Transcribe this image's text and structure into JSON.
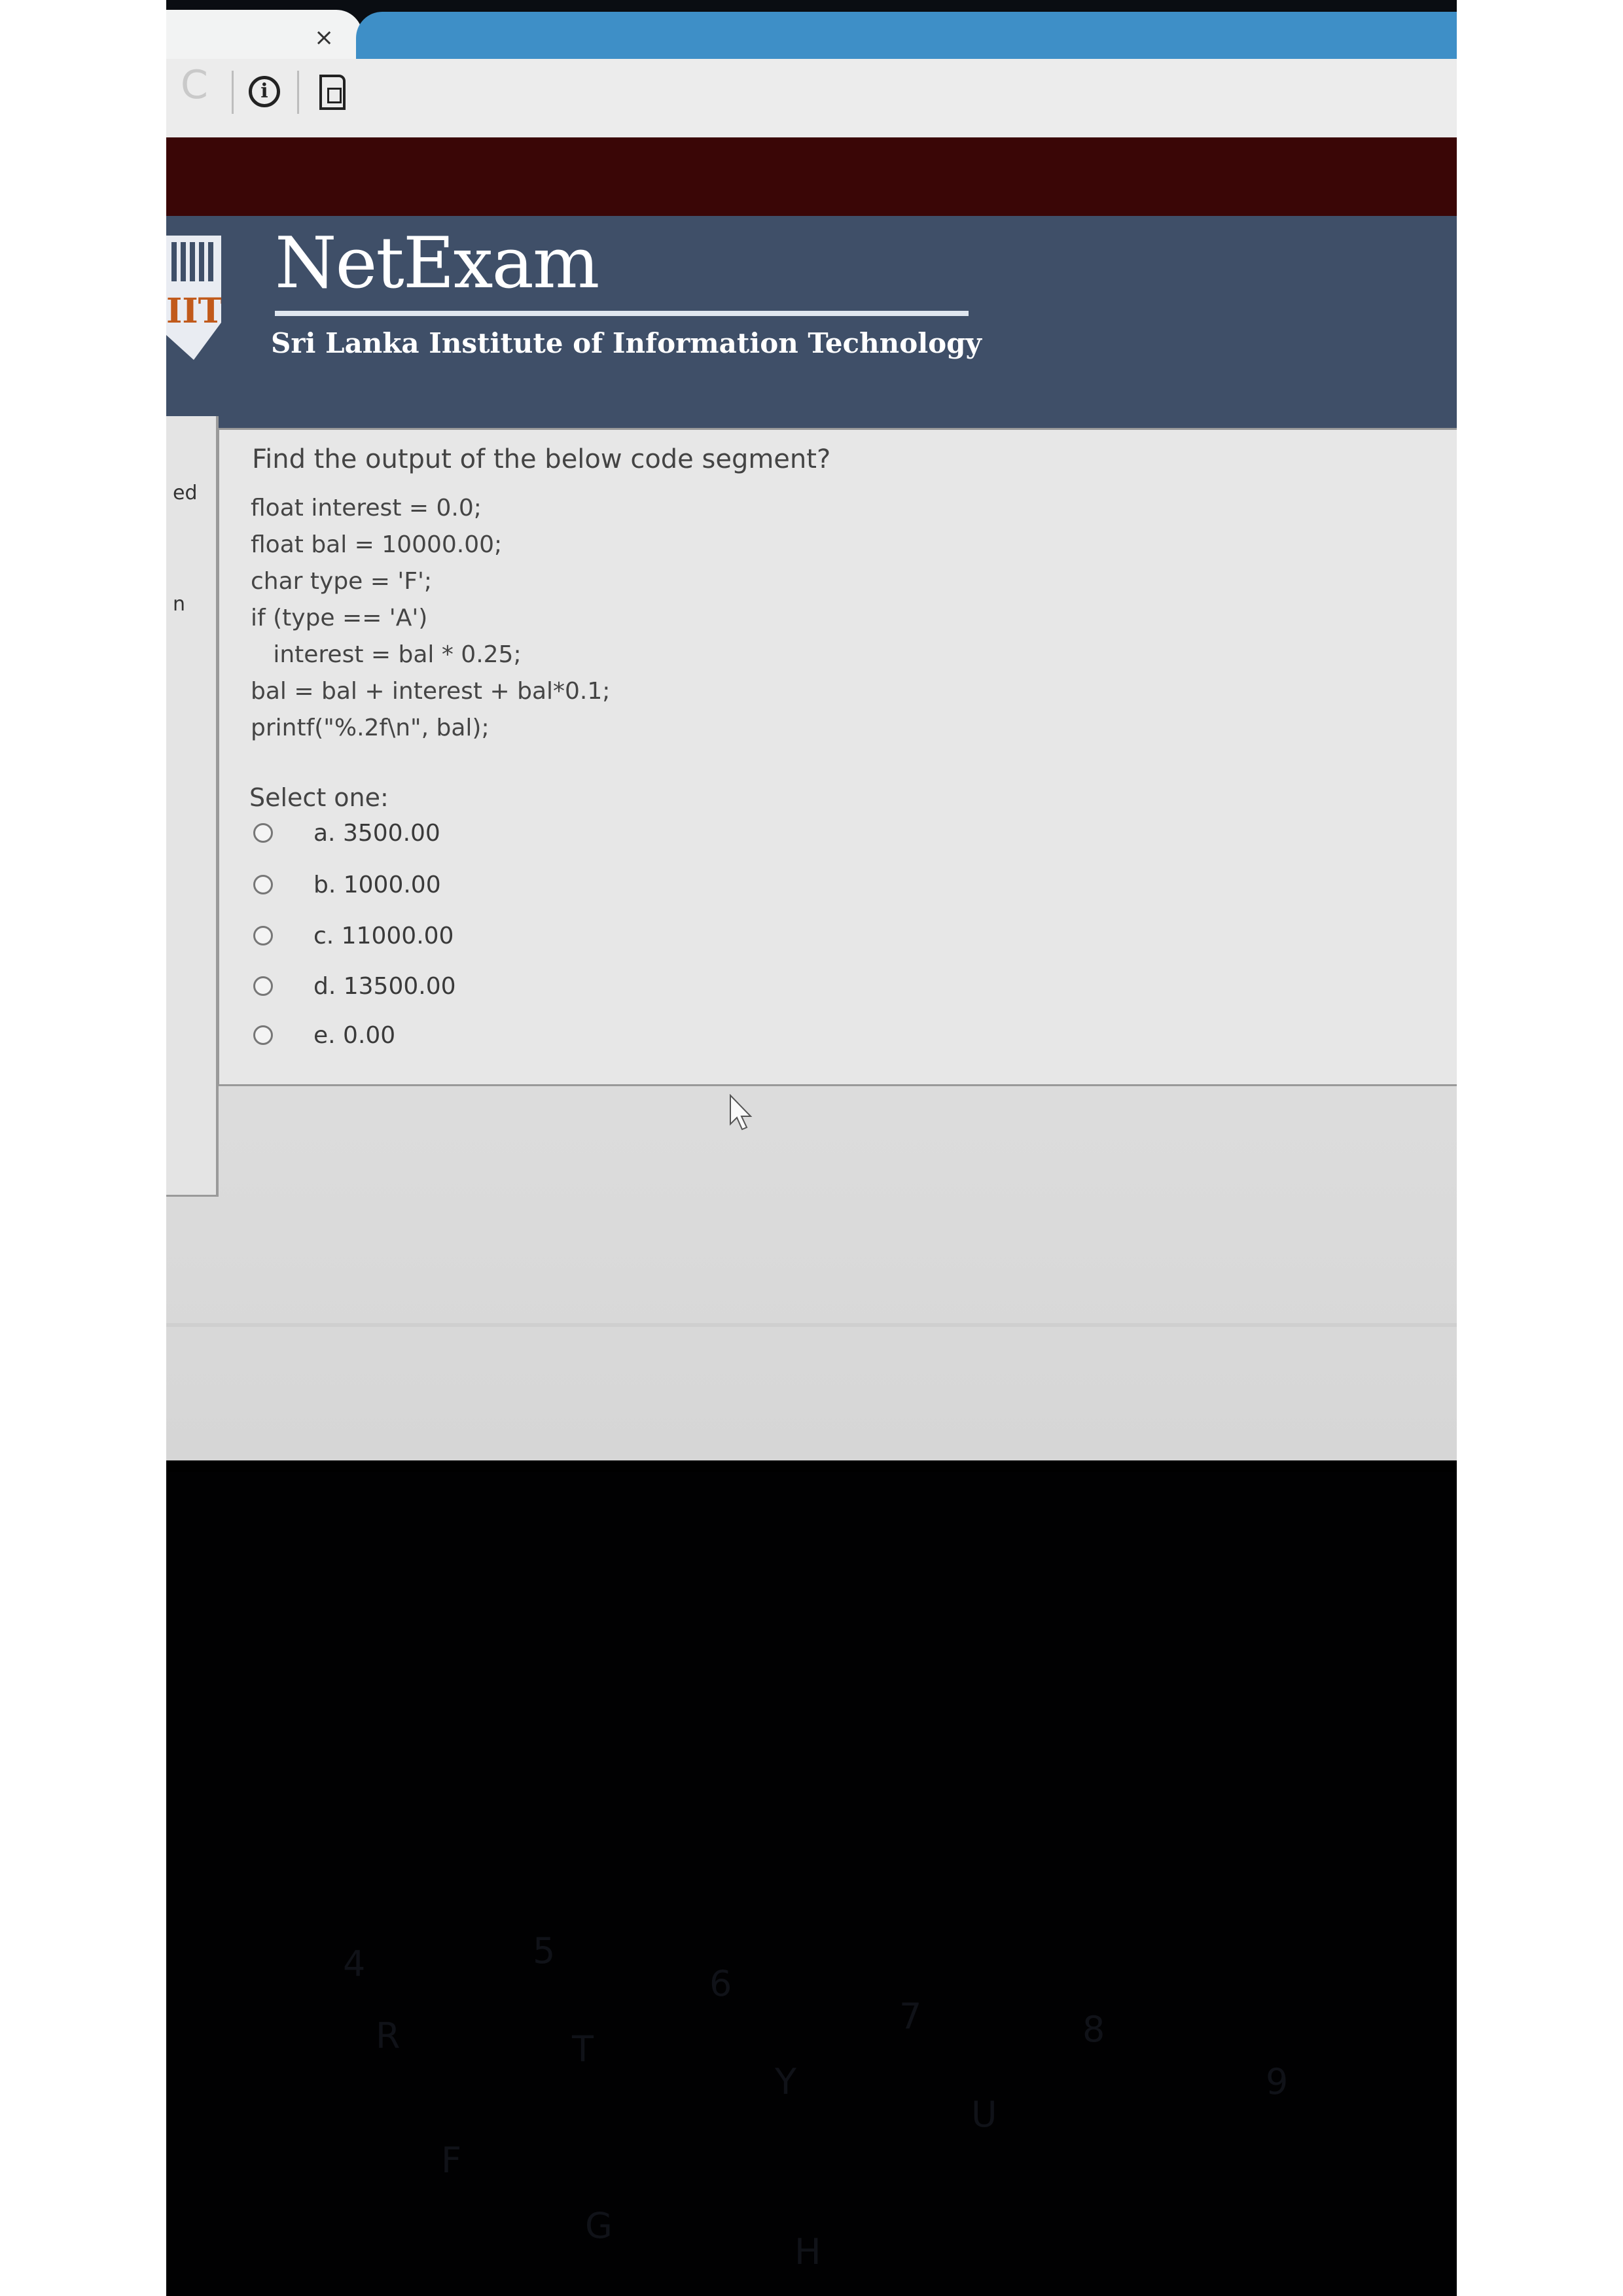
{
  "browser": {
    "tab_close_glyph": "×",
    "reload_glyph": "C",
    "info_glyph": "i"
  },
  "header": {
    "title": "NetExam",
    "subtitle": "Sri Lanka Institute of Information Technology",
    "logo_text": "IIT"
  },
  "sidebar": {
    "fragment_1": "ed",
    "fragment_2": "n"
  },
  "question": {
    "prompt": "Find the output of the below code segment?",
    "code": "float interest = 0.0;\nfloat bal = 10000.00;\nchar type = 'F';\nif (type == 'A')\n   interest = bal * 0.25;\nbal = bal + interest + bal*0.1;\nprintf(\"%.2f\\n\", bal);",
    "select_label": "Select one:",
    "options": [
      {
        "label": "a. 3500.00"
      },
      {
        "label": "b. 1000.00"
      },
      {
        "label": "c. 11000.00"
      },
      {
        "label": "d. 13500.00"
      },
      {
        "label": "e. 0.00"
      }
    ]
  },
  "keyboard": {
    "keys": [
      "4",
      "5",
      "R",
      "T",
      "6",
      "Y",
      "7",
      "U",
      "8",
      "9",
      "F",
      "G",
      "H"
    ]
  },
  "colors": {
    "header_bg": "#3f4f68",
    "header_accent": "#e4691f",
    "top_bar": "#3a0606",
    "tab_blue": "#3e8fc7"
  }
}
